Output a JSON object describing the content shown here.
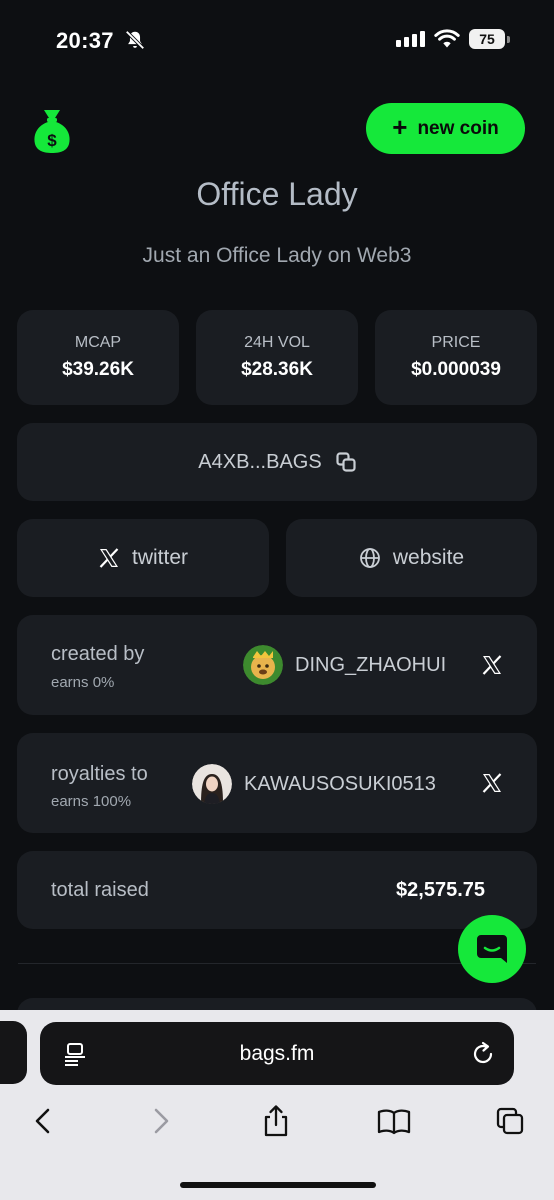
{
  "status_bar": {
    "time": "20:37",
    "battery": "75"
  },
  "header": {
    "new_coin_label": "new coin"
  },
  "token": {
    "name": "Office Lady",
    "description": "Just an Office Lady on Web3"
  },
  "stats": [
    {
      "label": "MCAP",
      "value": "$39.26K"
    },
    {
      "label": "24H VOL",
      "value": "$28.36K"
    },
    {
      "label": "PRICE",
      "value": "$0.000039"
    }
  ],
  "address": {
    "short": "A4XB...BAGS"
  },
  "links": {
    "twitter": "twitter",
    "website": "website"
  },
  "creator": {
    "label": "created by",
    "earns": "earns 0%",
    "username": "DING_ZHAOHUI"
  },
  "royalties": {
    "label": "royalties to",
    "earns": "earns 100%",
    "username": "KAWAUSOSUKI0513"
  },
  "raised": {
    "label": "total raised",
    "value": "$2,575.75"
  },
  "browser": {
    "url": "bags.fm"
  },
  "colors": {
    "accent": "#15e83a",
    "background": "#0d0f12",
    "card": "#1a1d22"
  },
  "icons": [
    "bell-muted-icon",
    "signal-icon",
    "wifi-icon",
    "money-bag-icon",
    "copy-icon",
    "x-logo-icon",
    "globe-icon",
    "chat-icon",
    "reader-icon",
    "reload-icon",
    "back-icon",
    "forward-icon",
    "share-icon",
    "bookmarks-icon",
    "tabs-icon"
  ]
}
